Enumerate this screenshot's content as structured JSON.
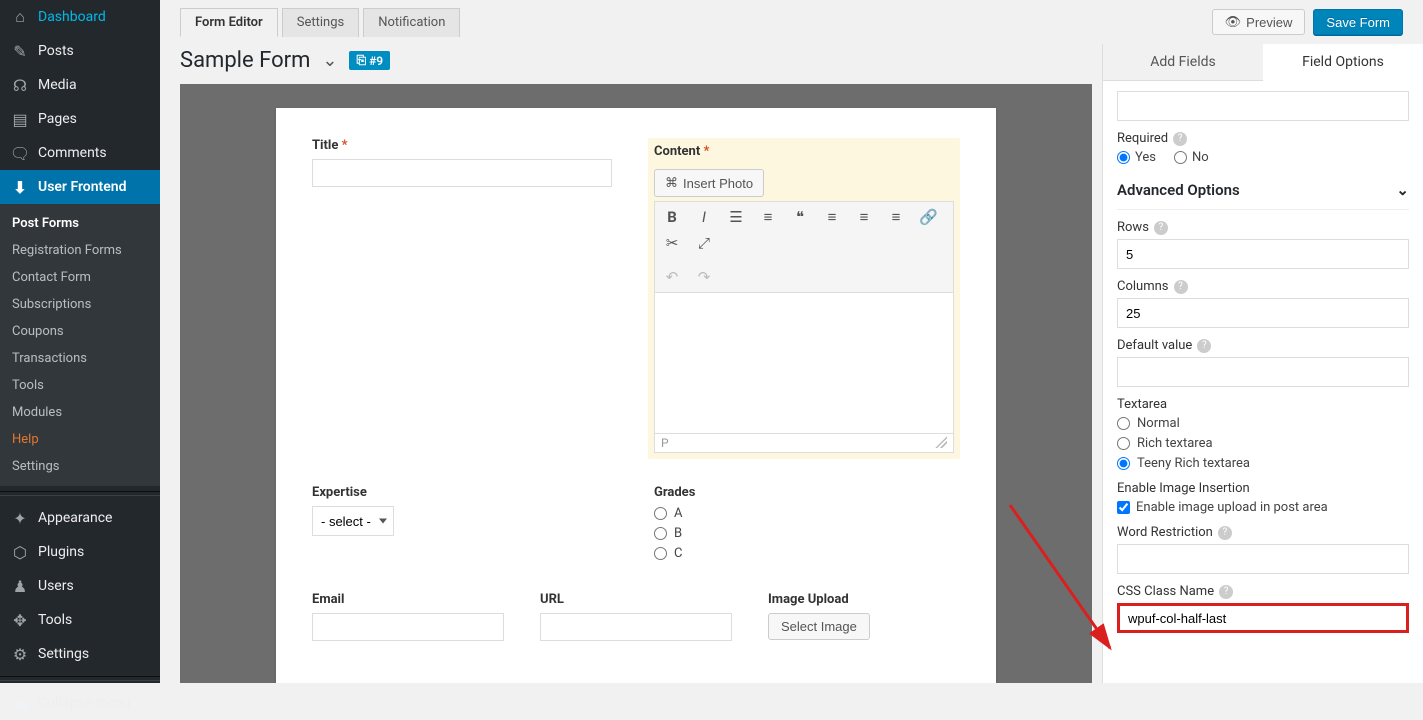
{
  "sidebar": {
    "main": [
      {
        "icon": "◉",
        "label": "Dashboard"
      },
      {
        "icon": "✎",
        "label": "Posts"
      },
      {
        "icon": "☊",
        "label": "Media"
      },
      {
        "icon": "▤",
        "label": "Pages"
      },
      {
        "icon": "💬",
        "label": "Comments"
      },
      {
        "icon": "⬇",
        "label": "User Frontend",
        "current": true
      }
    ],
    "submenu": [
      {
        "label": "Post Forms",
        "active": true
      },
      {
        "label": "Registration Forms"
      },
      {
        "label": "Contact Form"
      },
      {
        "label": "Subscriptions"
      },
      {
        "label": "Coupons"
      },
      {
        "label": "Transactions"
      },
      {
        "label": "Tools"
      },
      {
        "label": "Modules"
      },
      {
        "label": "Help",
        "help": true
      },
      {
        "label": "Settings"
      }
    ],
    "bottom": [
      {
        "icon": "✦",
        "label": "Appearance"
      },
      {
        "icon": "⬡",
        "label": "Plugins"
      },
      {
        "icon": "♟",
        "label": "Users"
      },
      {
        "icon": "✥",
        "label": "Tools"
      },
      {
        "icon": "⚙",
        "label": "Settings"
      }
    ],
    "collapse": {
      "icon": "◀",
      "label": "Collapse menu"
    }
  },
  "topbar": {
    "tabs": [
      {
        "label": "Form Editor",
        "active": true
      },
      {
        "label": "Settings"
      },
      {
        "label": "Notification"
      }
    ],
    "preview": "Preview",
    "save": "Save Form"
  },
  "form": {
    "title": "Sample Form",
    "id_badge": "#9",
    "fields": {
      "title": "Title",
      "content": "Content",
      "insert_photo": "Insert Photo",
      "status_p": "P",
      "expertise": "Expertise",
      "expertise_placeholder": "- select -",
      "grades": "Grades",
      "grade_opts": [
        "A",
        "B",
        "C"
      ],
      "email": "Email",
      "url": "URL",
      "image_upload": "Image Upload",
      "select_image": "Select Image"
    }
  },
  "rp": {
    "tabs": {
      "add": "Add Fields",
      "opts": "Field Options"
    },
    "required": {
      "label": "Required",
      "yes": "Yes",
      "no": "No"
    },
    "advanced": "Advanced Options",
    "rows": {
      "label": "Rows",
      "value": "5"
    },
    "columns": {
      "label": "Columns",
      "value": "25"
    },
    "default": {
      "label": "Default value",
      "value": ""
    },
    "textarea": {
      "label": "Textarea",
      "opts": [
        "Normal",
        "Rich textarea",
        "Teeny Rich textarea"
      ]
    },
    "image_ins": {
      "label": "Enable Image Insertion",
      "check": "Enable image upload in post area"
    },
    "word": {
      "label": "Word Restriction",
      "value": ""
    },
    "css": {
      "label": "CSS Class Name",
      "value": "wpuf-col-half-last"
    }
  }
}
